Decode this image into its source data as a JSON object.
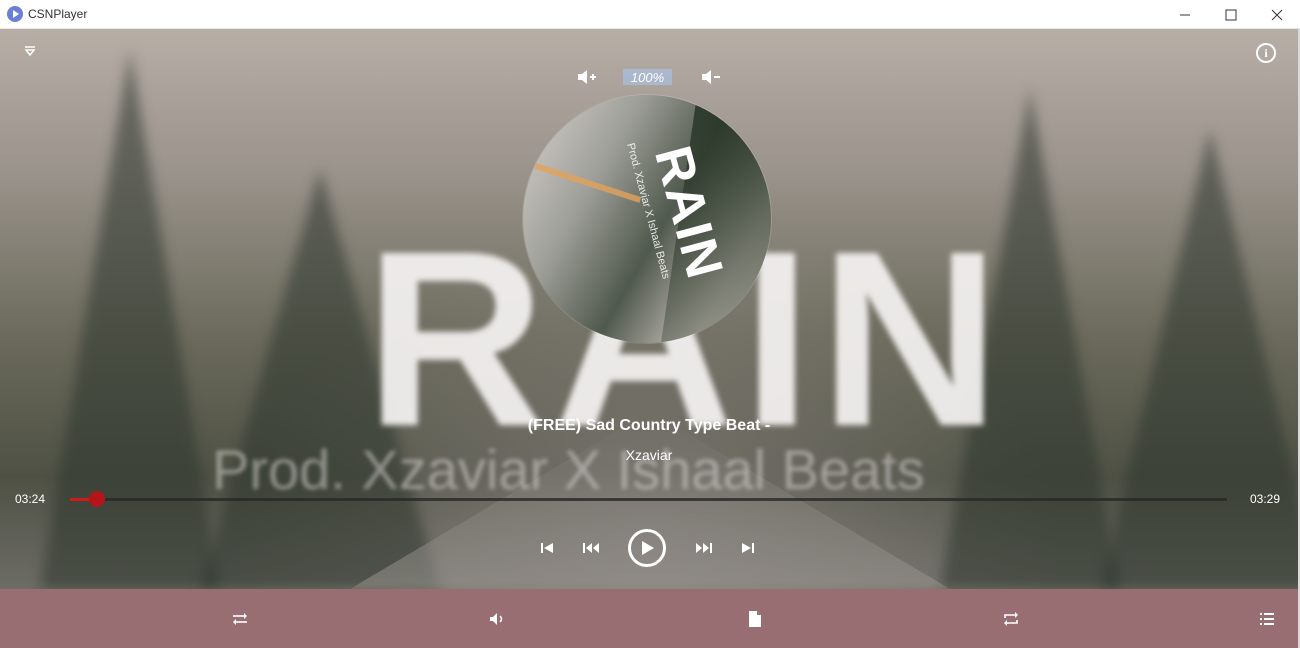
{
  "window": {
    "title": "CSNPlayer",
    "icon": "app-play-icon",
    "controls": [
      "minimize-icon",
      "maximize-icon",
      "close-icon"
    ]
  },
  "background": {
    "word": "RAIN",
    "subtitle": "Prod. Xzaviar X Ishaal Beats"
  },
  "album_art": {
    "word": "RAIN",
    "credit": "Prod. Xzaviar X Ishaal Beats"
  },
  "volume": {
    "level_label": "100%",
    "level": 1.0,
    "up_icon": "volume-up-icon",
    "down_icon": "volume-down-icon"
  },
  "track": {
    "title": "(FREE) Sad Country Type Beat -",
    "artist": "Xzaviar"
  },
  "progress": {
    "current": "03:24",
    "total": "03:29",
    "fraction": 0.023
  },
  "transport": [
    "skip-previous-icon",
    "rewind-icon",
    "play-icon",
    "fast-forward-icon",
    "skip-next-icon"
  ],
  "bottom_bar": [
    "shuffle-icon",
    "volume-icon",
    "file-icon",
    "repeat-icon",
    "playlist-icon"
  ],
  "colors": {
    "accent": "#d0191b",
    "bottom_bar": "#996e73",
    "volume_badge": "#aabedc"
  }
}
